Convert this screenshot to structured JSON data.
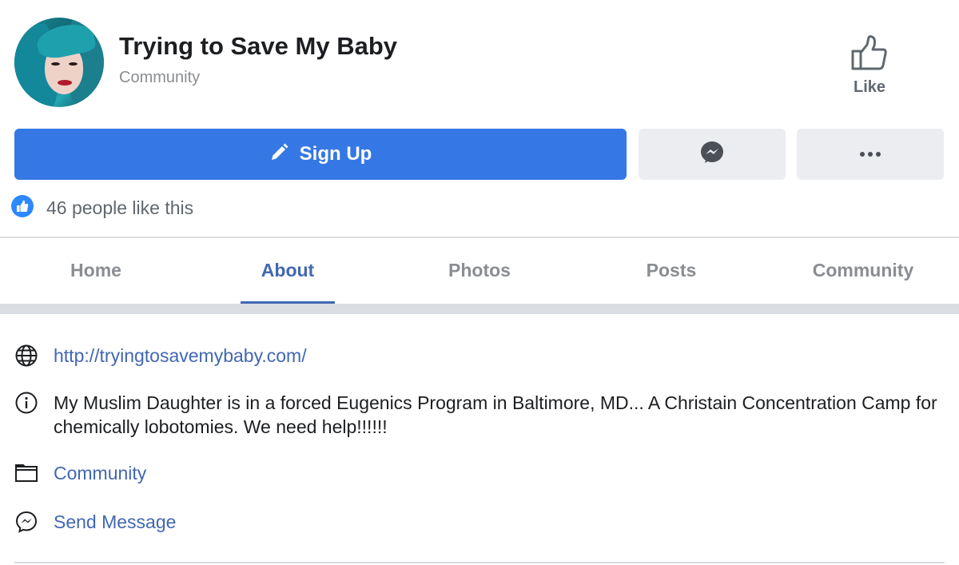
{
  "page": {
    "title": "Trying to Save My Baby",
    "category": "Community"
  },
  "actions": {
    "like_label": "Like",
    "signup_label": "Sign Up"
  },
  "likes": {
    "text": "46 people like this"
  },
  "tabs": [
    {
      "label": "Home",
      "active": false
    },
    {
      "label": "About",
      "active": true
    },
    {
      "label": "Photos",
      "active": false
    },
    {
      "label": "Posts",
      "active": false
    },
    {
      "label": "Community",
      "active": false
    }
  ],
  "about": {
    "website": "http://tryingtosavemybaby.com/",
    "description": "My Muslim Daughter is in a forced Eugenics Program in Baltimore, MD... A Christain Concentration Camp for  chemically lobotomies. We need help!!!!!!",
    "category_link": "Community",
    "send_message": "Send Message"
  },
  "colors": {
    "accent": "#3578e5",
    "link": "#4267b2",
    "muted": "#8a8d91",
    "button_gray": "#ebedf0"
  },
  "icons": {
    "like": "thumbs-up-outline-icon",
    "signup": "pencil-icon",
    "messenger": "messenger-icon",
    "more": "ellipsis-icon",
    "likes_badge": "like-badge-icon",
    "website": "globe-icon",
    "info": "info-icon",
    "category": "folder-icon",
    "message": "messenger-outline-icon"
  }
}
